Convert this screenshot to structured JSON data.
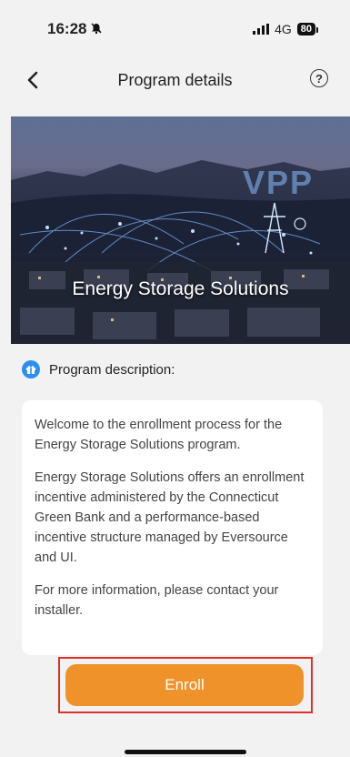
{
  "status_bar": {
    "time": "16:28",
    "network": "4G",
    "battery": "80"
  },
  "header": {
    "title": "Program details",
    "help_glyph": "?"
  },
  "hero": {
    "title": "Energy Storage Solutions",
    "badge_text": "VPP"
  },
  "section": {
    "label": "Program description:"
  },
  "description": {
    "paragraphs": [
      "Welcome to the enrollment process for the Energy Storage Solutions program.",
      "Energy Storage Solutions offers an enrollment incentive administered by the Connecticut Green Bank and a performance-based incentive structure managed by Eversource and UI.",
      "For more information, please contact your installer."
    ]
  },
  "actions": {
    "enroll_label": "Enroll"
  },
  "colors": {
    "accent": "#f0922a",
    "highlight": "#e0302a",
    "info": "#2a8ff0"
  },
  "icons": [
    "bell-muted-icon",
    "signal-icon",
    "battery-icon",
    "back-chevron-icon",
    "help-icon",
    "gift-icon"
  ]
}
